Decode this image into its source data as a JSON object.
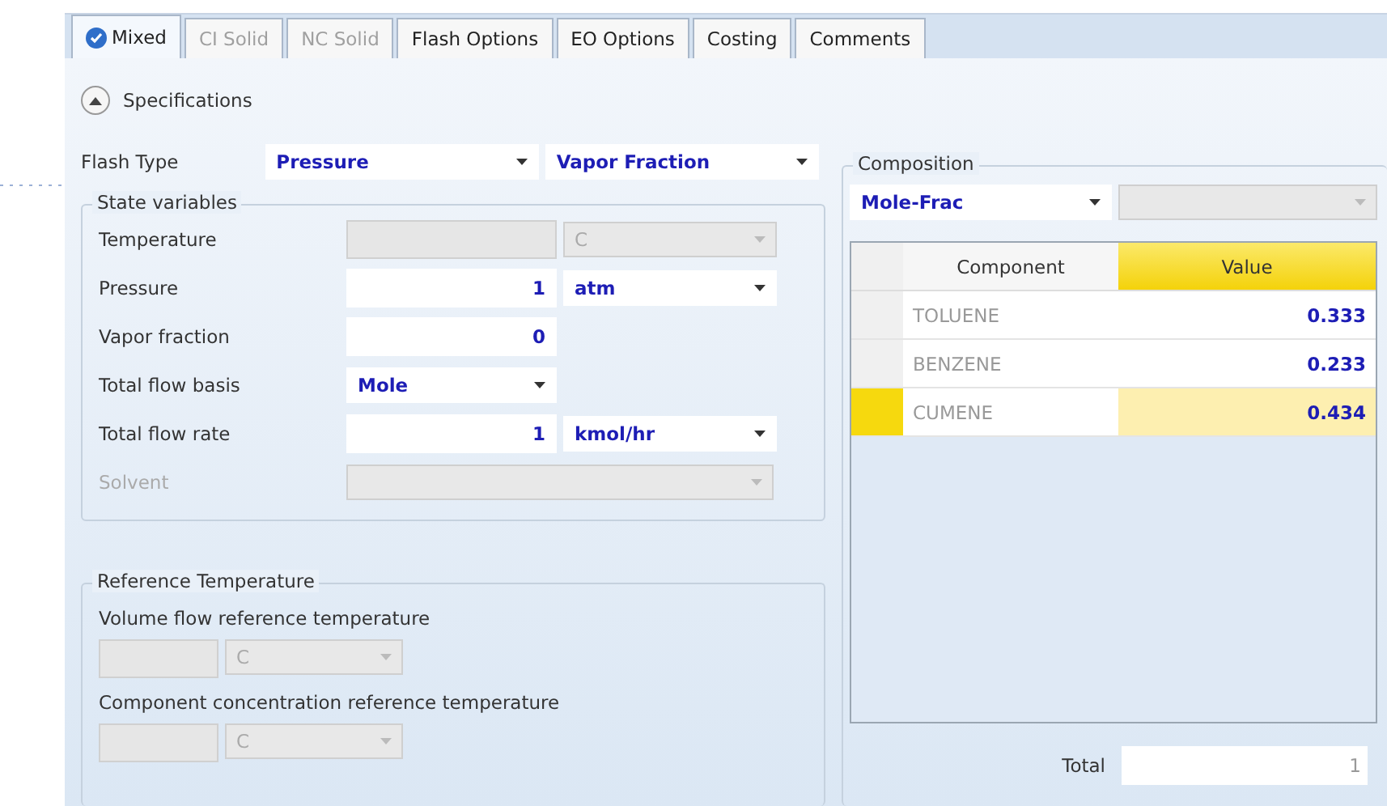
{
  "tabs": [
    {
      "label": "Mixed",
      "selected": true,
      "disabled": false,
      "checked": true
    },
    {
      "label": "CI Solid",
      "selected": false,
      "disabled": true,
      "checked": false
    },
    {
      "label": "NC Solid",
      "selected": false,
      "disabled": true,
      "checked": false
    },
    {
      "label": "Flash Options",
      "selected": false,
      "disabled": false,
      "checked": false
    },
    {
      "label": "EO Options",
      "selected": false,
      "disabled": false,
      "checked": false
    },
    {
      "label": "Costing",
      "selected": false,
      "disabled": false,
      "checked": false
    },
    {
      "label": "Comments",
      "selected": false,
      "disabled": false,
      "checked": false
    }
  ],
  "specifications": {
    "label": "Specifications",
    "expanded": true
  },
  "flash_type": {
    "label": "Flash Type",
    "options": [
      "Pressure",
      "Vapor Fraction"
    ]
  },
  "state_variables": {
    "title": "State variables",
    "rows": [
      {
        "kind": "value_unit",
        "label": "Temperature",
        "label_dimmed": false,
        "disabled": true,
        "unit": "C"
      },
      {
        "kind": "value_unit",
        "label": "Pressure",
        "label_dimmed": false,
        "disabled": false,
        "value": "1",
        "unit": "atm"
      },
      {
        "kind": "value",
        "label": "Vapor fraction",
        "label_dimmed": false,
        "disabled": false,
        "value": "0"
      },
      {
        "kind": "select",
        "label": "Total flow basis",
        "label_dimmed": false,
        "disabled": false,
        "value": "Mole"
      },
      {
        "kind": "value_unit",
        "label": "Total flow rate",
        "label_dimmed": false,
        "disabled": false,
        "value": "1",
        "unit": "kmol/hr"
      },
      {
        "kind": "wide_select",
        "label": "Solvent",
        "label_dimmed": true,
        "disabled": true
      }
    ]
  },
  "reference_temperature": {
    "title": "Reference Temperature",
    "items": [
      {
        "label": "Volume flow reference temperature",
        "unit": "C"
      },
      {
        "label": "Component concentration reference temperature",
        "unit": "C"
      }
    ]
  },
  "composition": {
    "title": "Composition",
    "basis": "Mole-Frac",
    "columns": [
      "Component",
      "Value"
    ],
    "rows": [
      {
        "component": "TOLUENE",
        "value": "0.333",
        "selected": false
      },
      {
        "component": "BENZENE",
        "value": "0.233",
        "selected": false
      },
      {
        "component": "CUMENE",
        "value": "0.434",
        "selected": true
      }
    ],
    "total": {
      "label": "Total",
      "value": "1"
    }
  }
}
